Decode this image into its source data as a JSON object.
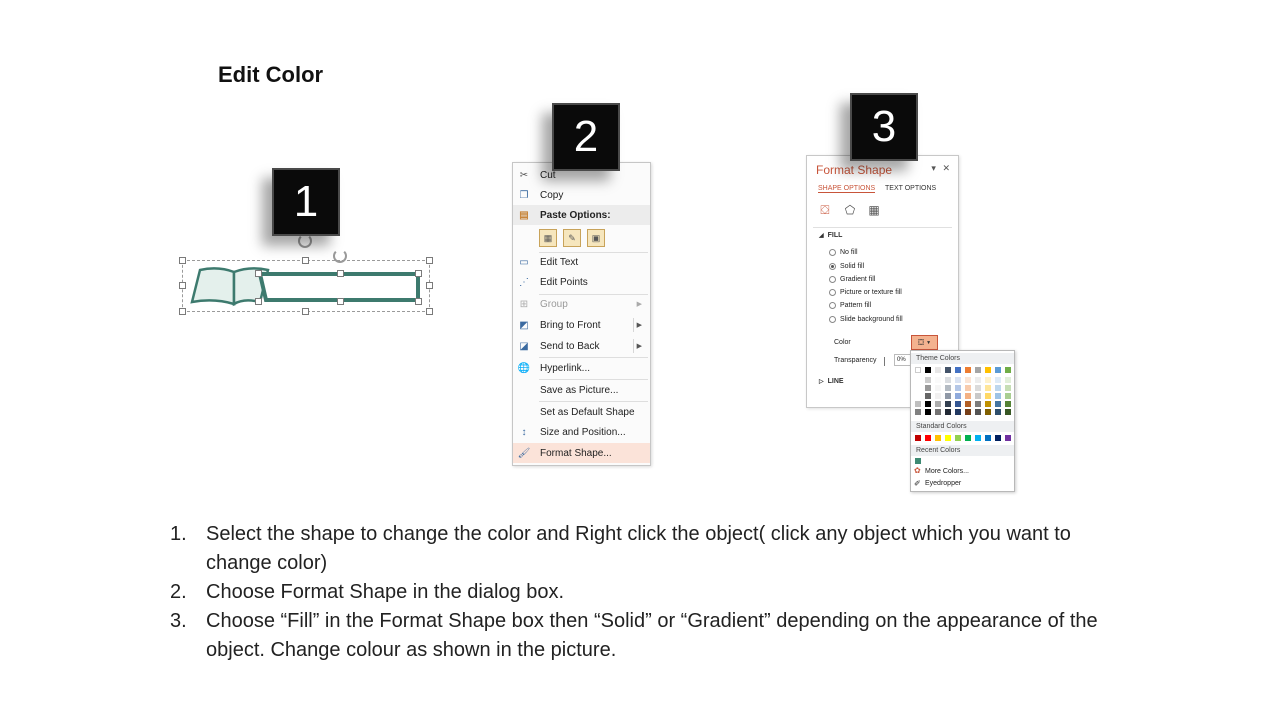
{
  "title": "Edit Color",
  "badges": [
    "1",
    "2",
    "3"
  ],
  "context_menu": {
    "items": [
      {
        "label": "Cut",
        "icon": "scissors-icon"
      },
      {
        "label": "Copy",
        "icon": "copy-icon"
      },
      {
        "label": "Paste Options:",
        "icon": "paste-icon"
      },
      {
        "label": "Edit Text",
        "icon": "edit-text-icon"
      },
      {
        "label": "Edit Points",
        "icon": "edit-points-icon"
      },
      {
        "label": "Group",
        "icon": "group-icon"
      },
      {
        "label": "Bring to Front",
        "icon": "bring-front-icon"
      },
      {
        "label": "Send to Back",
        "icon": "send-back-icon"
      },
      {
        "label": "Hyperlink...",
        "icon": "hyperlink-icon"
      },
      {
        "label": "Save as Picture...",
        "icon": ""
      },
      {
        "label": "Set as Default Shape",
        "icon": ""
      },
      {
        "label": "Size and Position...",
        "icon": "size-position-icon"
      },
      {
        "label": "Format Shape...",
        "icon": "format-shape-icon"
      }
    ]
  },
  "format_pane": {
    "title": "Format Shape",
    "tab_shape": "SHAPE OPTIONS",
    "tab_text": "TEXT OPTIONS",
    "fill_section": "FILL",
    "fill_options": [
      "No fill",
      "Solid fill",
      "Gradient fill",
      "Picture or texture fill",
      "Pattern fill",
      "Slide background fill"
    ],
    "selected_fill": "Solid fill",
    "color_label": "Color",
    "transparency_label": "Transparency",
    "transparency_value": "0%",
    "line_section": "LINE"
  },
  "color_picker": {
    "theme_header": "Theme Colors",
    "standard_header": "Standard Colors",
    "recent_header": "Recent Colors",
    "more_colors": "More Colors...",
    "eyedropper": "Eyedropper",
    "theme_top": [
      "#ffffff",
      "#000000",
      "#e7e6e6",
      "#44546a",
      "#4472c4",
      "#ed7d31",
      "#a5a5a5",
      "#ffc000",
      "#5b9bd5",
      "#70ad47"
    ],
    "standard": [
      "#c00000",
      "#ff0000",
      "#ffc000",
      "#ffff00",
      "#92d050",
      "#00b050",
      "#00b0f0",
      "#0070c0",
      "#002060",
      "#7030a0"
    ],
    "recent": [
      "#3d8a73"
    ]
  },
  "shape_color": "#3d7a6e",
  "steps": [
    {
      "num": "1.",
      "text": "Select the shape to change the color and Right click the object( click any object which you want to change color)"
    },
    {
      "num": "2.",
      "text": "Choose Format Shape in the dialog box."
    },
    {
      "num": "3.",
      "text": "Choose “Fill” in the Format Shape box then “Solid” or “Gradient” depending on the appearance of the object. Change colour as shown in the picture."
    }
  ]
}
